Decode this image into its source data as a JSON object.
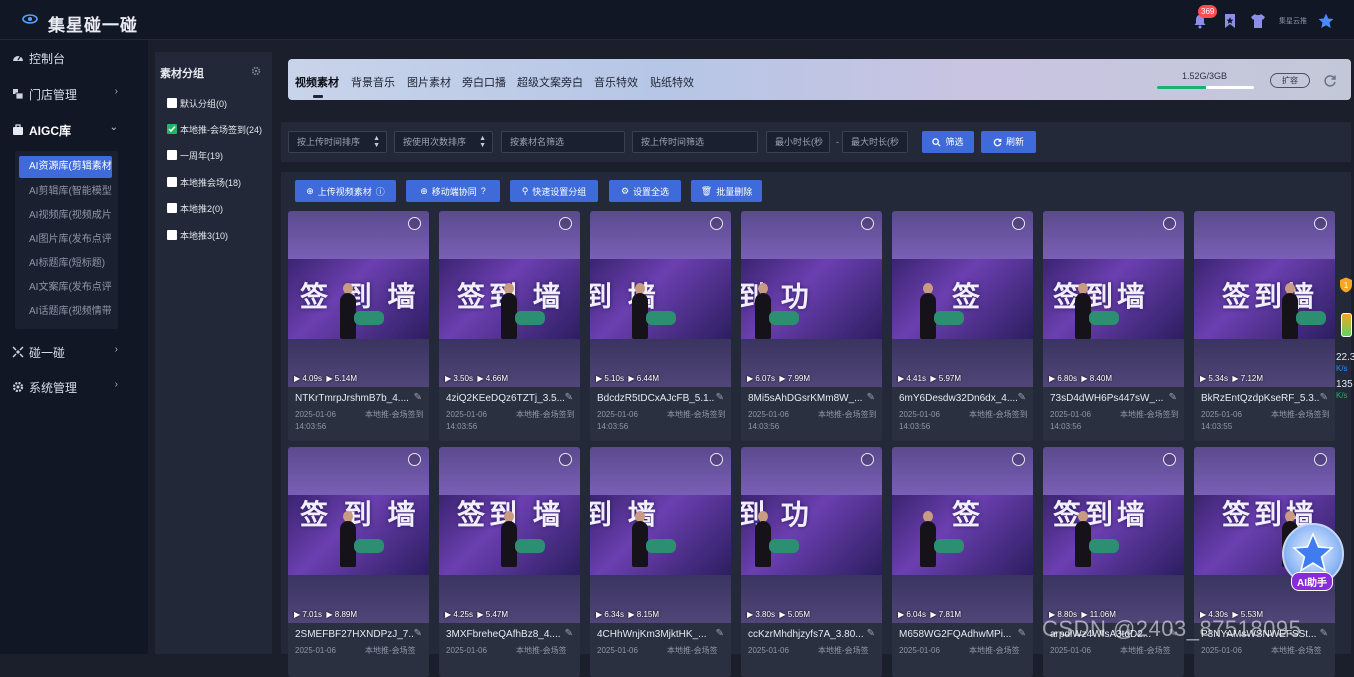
{
  "app": {
    "title": "集星碰一碰",
    "notification_count": "369",
    "user_name": "集星云推"
  },
  "sidebar": {
    "items": [
      {
        "label": "控制台"
      },
      {
        "label": "门店管理"
      },
      {
        "label": "AIGC库"
      },
      {
        "label": "碰一碰"
      },
      {
        "label": "系统管理"
      }
    ],
    "submenu": [
      "AI资源库(剪辑素材)",
      "AI剪辑库(智能模型)",
      "AI视频库(视频成片)",
      "AI图片库(发布点评)",
      "AI标题库(短标题)",
      "AI文案库(发布点评)",
      "AI话题库(视频情带)"
    ]
  },
  "groups": {
    "title": "素材分组",
    "items": [
      {
        "label": "默认分组(0)",
        "checked": false
      },
      {
        "label": "本地推-会场签到(24)",
        "checked": true
      },
      {
        "label": "一周年(19)",
        "checked": false
      },
      {
        "label": "本地推会场(18)",
        "checked": false
      },
      {
        "label": "本地推2(0)",
        "checked": false
      },
      {
        "label": "本地推3(10)",
        "checked": false
      }
    ]
  },
  "tabs": [
    "视频素材",
    "背景音乐",
    "图片素材",
    "旁白口播",
    "超级文案旁白",
    "音乐特效",
    "贴纸特效"
  ],
  "storage": {
    "text": "1.52G/3GB",
    "fraction": 0.51,
    "expand_label": "扩容"
  },
  "filters": {
    "sort_upload": "按上传时间排序",
    "sort_usage": "按使用次数排序",
    "name_placeholder": "按素材名筛选",
    "time_placeholder": "按上传时间筛选",
    "min_duration": "最小时长(秒",
    "max_duration": "最大时长(秒",
    "filter_label": "筛选",
    "refresh_label": "刷新"
  },
  "actions": {
    "upload": "上传视频素材",
    "mobile": "移动端协同",
    "quick_group": "快速设置分组",
    "select_all": "设置全选",
    "batch_delete": "批量删除"
  },
  "cards": [
    {
      "name": "NTKrTmrpJrshmB7b_4....",
      "duration": "4.09s",
      "size": "5.14M",
      "date": "2025-01-06 14:03:56",
      "group": "本地推-会场签到"
    },
    {
      "name": "4ziQ2KEeDQz6TZTj_3.5...",
      "duration": "3.50s",
      "size": "4.66M",
      "date": "2025-01-06 14:03:56",
      "group": "本地推-会场签到"
    },
    {
      "name": "BdcdzR5tDCxAJcFB_5.1...",
      "duration": "5.10s",
      "size": "6.44M",
      "date": "2025-01-06 14:03:56",
      "group": "本地推-会场签到"
    },
    {
      "name": "8Mi5sAhDGsrKMm8W_...",
      "duration": "6.07s",
      "size": "7.99M",
      "date": "2025-01-06 14:03:56",
      "group": "本地推-会场签到"
    },
    {
      "name": "6mY6Desdw32Dn6dx_4....",
      "duration": "4.41s",
      "size": "5.97M",
      "date": "2025-01-06 14:03:56",
      "group": "本地推-会场签到"
    },
    {
      "name": "73sD4dWH6Ps447sW_...",
      "duration": "6.80s",
      "size": "8.40M",
      "date": "2025-01-06 14:03:56",
      "group": "本地推-会场签到"
    },
    {
      "name": "BkRzEntQzdpKseRF_5.3...",
      "duration": "5.34s",
      "size": "7.12M",
      "date": "2025-01-06 14:03:55",
      "group": "本地推-会场签到"
    },
    {
      "name": "2SMEFBF27HXNDPzJ_7...",
      "duration": "7.01s",
      "size": "8.89M",
      "date": "2025-01-06",
      "group": "本地推-会场签"
    },
    {
      "name": "3MXFbreheQAfhBz8_4....",
      "duration": "4.25s",
      "size": "5.47M",
      "date": "2025-01-06",
      "group": "本地推-会场签"
    },
    {
      "name": "4CHhWnjKm3MjktHK_...",
      "duration": "6.34s",
      "size": "8.15M",
      "date": "2025-01-06",
      "group": "本地推-会场签"
    },
    {
      "name": "ccKzrMhdhjzyfs7A_3.80...",
      "duration": "3.80s",
      "size": "5.05M",
      "date": "2025-01-06",
      "group": "本地推-会场签"
    },
    {
      "name": "M658WG2FQAdhwMPi...",
      "duration": "6.04s",
      "size": "7.81M",
      "date": "2025-01-06",
      "group": "本地推-会场签"
    },
    {
      "name": "arpdiWz4WfsA3tdD2...",
      "duration": "8.80s",
      "size": "11.06M",
      "date": "2025-01-06",
      "group": "本地推-会场签"
    },
    {
      "name": "P3NYAMsWSNWEFSSt...",
      "duration": "4.30s",
      "size": "5.53M",
      "date": "2025-01-06",
      "group": "本地推-会场签"
    }
  ],
  "widgets": {
    "net_top": "22.3",
    "net_unit": "K/s",
    "net_bottom": "135",
    "badge": "1"
  },
  "ai_assistant": {
    "label": "AI助手"
  },
  "watermark": "CSDN @2403_87518095",
  "colors": {
    "accent": "#3e6bd9",
    "success": "#23b46a",
    "badge": "#ff4d4f"
  }
}
